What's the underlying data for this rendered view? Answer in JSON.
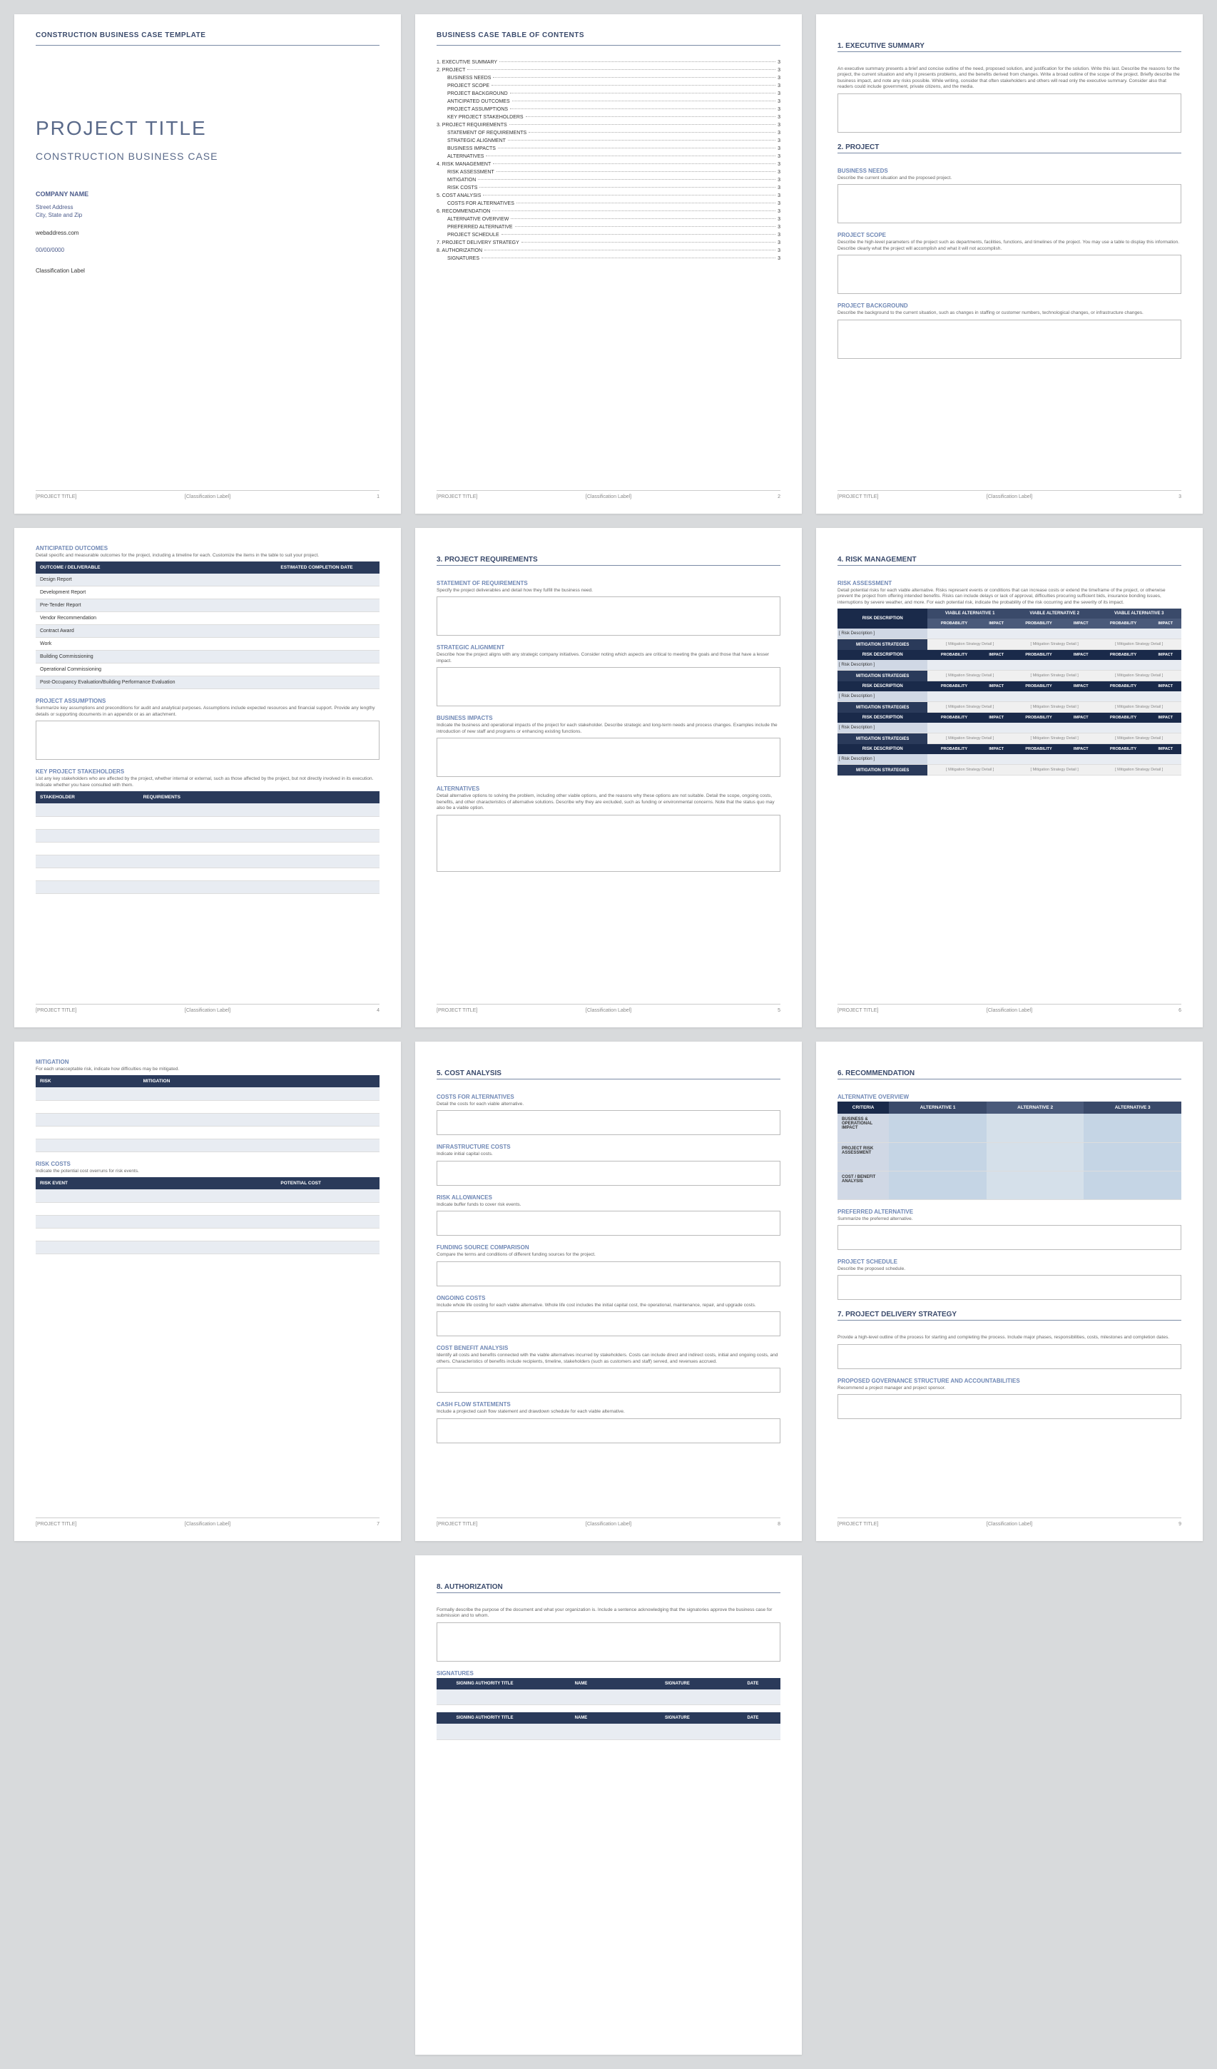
{
  "doc": {
    "header": "CONSTRUCTION BUSINESS CASE TEMPLATE",
    "project_title": "PROJECT TITLE",
    "subtitle": "CONSTRUCTION BUSINESS CASE",
    "company": "COMPANY NAME",
    "street": "Street Address",
    "city": "City, State and Zip",
    "web": "webaddress.com",
    "date": "00/00/0000",
    "classification": "Classification Label",
    "footer_title": "[PROJECT TITLE]",
    "footer_class": "[Classification Label]"
  },
  "toc": {
    "title": "BUSINESS CASE TABLE OF CONTENTS",
    "items": [
      {
        "n": "1.",
        "t": "EXECUTIVE SUMMARY",
        "p": "3",
        "sub": false
      },
      {
        "n": "2.",
        "t": "PROJECT",
        "p": "3",
        "sub": false
      },
      {
        "n": "",
        "t": "BUSINESS NEEDS",
        "p": "3",
        "sub": true
      },
      {
        "n": "",
        "t": "PROJECT SCOPE",
        "p": "3",
        "sub": true
      },
      {
        "n": "",
        "t": "PROJECT BACKGROUND",
        "p": "3",
        "sub": true
      },
      {
        "n": "",
        "t": "ANTICIPATED OUTCOMES",
        "p": "3",
        "sub": true
      },
      {
        "n": "",
        "t": "PROJECT ASSUMPTIONS",
        "p": "3",
        "sub": true
      },
      {
        "n": "",
        "t": "KEY PROJECT STAKEHOLDERS",
        "p": "3",
        "sub": true
      },
      {
        "n": "3.",
        "t": "PROJECT REQUIREMENTS",
        "p": "3",
        "sub": false
      },
      {
        "n": "",
        "t": "STATEMENT OF REQUIREMENTS",
        "p": "3",
        "sub": true
      },
      {
        "n": "",
        "t": "STRATEGIC ALIGNMENT",
        "p": "3",
        "sub": true
      },
      {
        "n": "",
        "t": "BUSINESS IMPACTS",
        "p": "3",
        "sub": true
      },
      {
        "n": "",
        "t": "ALTERNATIVES",
        "p": "3",
        "sub": true
      },
      {
        "n": "4.",
        "t": "RISK MANAGEMENT",
        "p": "3",
        "sub": false
      },
      {
        "n": "",
        "t": "RISK ASSESSMENT",
        "p": "3",
        "sub": true
      },
      {
        "n": "",
        "t": "MITIGATION",
        "p": "3",
        "sub": true
      },
      {
        "n": "",
        "t": "RISK COSTS",
        "p": "3",
        "sub": true
      },
      {
        "n": "5.",
        "t": "COST ANALYSIS",
        "p": "3",
        "sub": false
      },
      {
        "n": "",
        "t": "COSTS FOR ALTERNATIVES",
        "p": "3",
        "sub": true
      },
      {
        "n": "6.",
        "t": "RECOMMENDATION",
        "p": "3",
        "sub": false
      },
      {
        "n": "",
        "t": "ALTERNATIVE OVERVIEW",
        "p": "3",
        "sub": true
      },
      {
        "n": "",
        "t": "PREFERRED ALTERNATIVE",
        "p": "3",
        "sub": true
      },
      {
        "n": "",
        "t": "PROJECT SCHEDULE",
        "p": "3",
        "sub": true
      },
      {
        "n": "7.",
        "t": "PROJECT DELIVERY STRATEGY",
        "p": "3",
        "sub": false
      },
      {
        "n": "8.",
        "t": "AUTHORIZATION",
        "p": "3",
        "sub": false
      },
      {
        "n": "",
        "t": "SIGNATURES",
        "p": "3",
        "sub": true
      }
    ]
  },
  "p3": {
    "s1": "1. EXECUTIVE SUMMARY",
    "s1d": "An executive summary presents a brief and concise outline of the need, proposed solution, and justification for the solution. Write this last. Describe the reasons for the project, the current situation and why it presents problems, and the benefits derived from changes. Write a broad outline of the scope of the project. Briefly describe the business impact, and note any risks possible. While writing, consider that often stakeholders and others will read only the executive summary. Consider also that readers could include government, private citizens, and the media.",
    "s2": "2. PROJECT",
    "bn": "BUSINESS NEEDS",
    "bnd": "Describe the current situation and the proposed project.",
    "ps": "PROJECT SCOPE",
    "psd": "Describe the high-level parameters of the project such as departments, facilities, functions, and timelines of the project. You may use a table to display this information. Describe clearly what the project will accomplish and what it will not accomplish.",
    "pb": "PROJECT BACKGROUND",
    "pbd": "Describe the background to the current situation, such as changes in staffing or customer numbers, technological changes, or infrastructure changes."
  },
  "p4": {
    "ao": "ANTICIPATED OUTCOMES",
    "aod": "Detail specific and measurable outcomes for the project, including a timeline for each. Customize the items in the table to suit your project.",
    "th1": "OUTCOME / DELIVERABLE",
    "th2": "ESTIMATED COMPLETION DATE",
    "rows": [
      "Design Report",
      "Development Report",
      "Pre-Tender Report",
      "Vendor Recommendation",
      "Contract Award",
      "Work",
      "Building Commissioning",
      "Operational Commissioning",
      "Post-Occupancy Evaluation/Building Performance Evaluation"
    ],
    "pa": "PROJECT ASSUMPTIONS",
    "pad": "Summarize key assumptions and preconditions for audit and analytical purposes. Assumptions include expected resources and financial support. Provide any lengthy details or supporting documents in an appendix or as an attachment.",
    "ks": "KEY PROJECT STAKEHOLDERS",
    "ksd": "List any key stakeholders who are affected by the project, whether internal or external, such as those affected by the project, but not directly involved in its execution. Indicate whether you have consulted with them.",
    "sth1": "STAKEHOLDER",
    "sth2": "REQUIREMENTS"
  },
  "p5": {
    "t": "3. PROJECT REQUIREMENTS",
    "sr": "STATEMENT OF REQUIREMENTS",
    "srd": "Specify the project deliverables and detail how they fulfill the business need.",
    "sa": "STRATEGIC ALIGNMENT",
    "sad": "Describe how the project aligns with any strategic company initiatives. Consider noting which aspects are critical to meeting the goals and those that have a lesser impact.",
    "bi": "BUSINESS IMPACTS",
    "bid": "Indicate the business and operational impacts of the project for each stakeholder. Describe strategic and long-term needs and process changes. Examples include the introduction of new staff and programs or enhancing existing functions.",
    "al": "ALTERNATIVES",
    "ald": "Detail alternative options to solving the problem, including other viable options, and the reasons why these options are not suitable. Detail the scope, ongoing costs, benefits, and other characteristics of alternative solutions. Describe why they are excluded, such as funding or environmental concerns. Note that the status quo may also be a viable option."
  },
  "p6": {
    "t": "4. RISK MANAGEMENT",
    "ra": "RISK ASSESSMENT",
    "rad": "Detail potential risks for each viable alternative. Risks represent events or conditions that can increase costs or extend the timeframe of the project, or otherwise prevent the project from offering intended benefits. Risks can include delays or lack of approval, difficulties procuring sufficient bids, insurance bonding issues, interruptions by severe weather, and more. For each potential risk, indicate the probability of the risk occurring and the severity of its impact.",
    "h_rd": "RISK DESCRIPTION",
    "h_va1": "VIABLE ALTERNATIVE 1",
    "h_va2": "VIABLE ALTERNATIVE 2",
    "h_va3": "VIABLE ALTERNATIVE 3",
    "h_prob": "PROBABILITY",
    "h_imp": "IMPACT",
    "h_ms": "MITIGATION STRATEGIES",
    "cell_rd": "[ Risk Description ]",
    "cell_ms": "[ Mitigation Strategy Detail ]"
  },
  "p7": {
    "mit": "MITIGATION",
    "mitd": "For each unacceptable risk, indicate how difficulties may be mitigated.",
    "th_risk": "RISK",
    "th_mit": "MITIGATION",
    "rc": "RISK COSTS",
    "rcd": "Indicate the potential cost overruns for risk events.",
    "th_re": "RISK EVENT",
    "th_pc": "POTENTIAL COST"
  },
  "p8": {
    "t": "5. COST ANALYSIS",
    "ca": "COSTS FOR ALTERNATIVES",
    "cad": "Detail the costs for each viable alternative.",
    "ic": "INFRASTRUCTURE COSTS",
    "icd": "Indicate initial capital costs.",
    "ral": "RISK ALLOWANCES",
    "rald": "Indicate buffer funds to cover risk events.",
    "fsc": "FUNDING SOURCE COMPARISON",
    "fscd": "Compare the terms and conditions of different funding sources for the project.",
    "oc": "ONGOING COSTS",
    "ocd": "Include whole life costing for each viable alternative. Whole life cost includes the initial capital cost, the operational, maintenance, repair, and upgrade costs.",
    "cba": "COST BENEFIT ANALYSIS",
    "cbad": "Identify all costs and benefits connected with the viable alternatives incurred by stakeholders. Costs can include direct and indirect costs, initial and ongoing costs, and others. Characteristics of benefits include recipients, timeline, stakeholders (such as customers and staff) served, and revenues accrued.",
    "cfs": "CASH FLOW STATEMENTS",
    "cfsd": "Include a projected cash flow statement and drawdown schedule for each viable alternative."
  },
  "p9": {
    "t": "6. RECOMMENDATION",
    "ao": "ALTERNATIVE OVERVIEW",
    "th_c": "CRITERIA",
    "th_a1": "ALTERNATIVE 1",
    "th_a2": "ALTERNATIVE 2",
    "th_a3": "ALTERNATIVE 3",
    "r1": "BUSINESS & OPERATIONAL IMPACT",
    "r2": "PROJECT RISK ASSESSMENT",
    "r3": "COST / BENEFIT ANALYSIS",
    "pa": "PREFERRED ALTERNATIVE",
    "pad": "Summarize the preferred alternative.",
    "ps": "PROJECT SCHEDULE",
    "psd": "Describe the proposed schedule.",
    "t2": "7. PROJECT DELIVERY STRATEGY",
    "t2d": "Provide a high-level outline of the process for starting and completing the process. Include major phases, responsibilities, costs, milestones and completion dates.",
    "pg": "PROPOSED GOVERNANCE STRUCTURE AND ACCOUNTABILITIES",
    "pgd": "Recommend a project manager and project sponsor."
  },
  "p10": {
    "t": "8. AUTHORIZATION",
    "td": "Formally describe the purpose of the document and what your organization is. Include a sentence acknowledging that the signatories approve the business case for submission and to whom.",
    "sig": "SIGNATURES",
    "th1": "SIGNING AUTHORITY TITLE",
    "th2": "NAME",
    "th3": "SIGNATURE",
    "th4": "DATE"
  },
  "pages": [
    "1",
    "2",
    "3",
    "4",
    "5",
    "6",
    "7",
    "8",
    "9"
  ]
}
